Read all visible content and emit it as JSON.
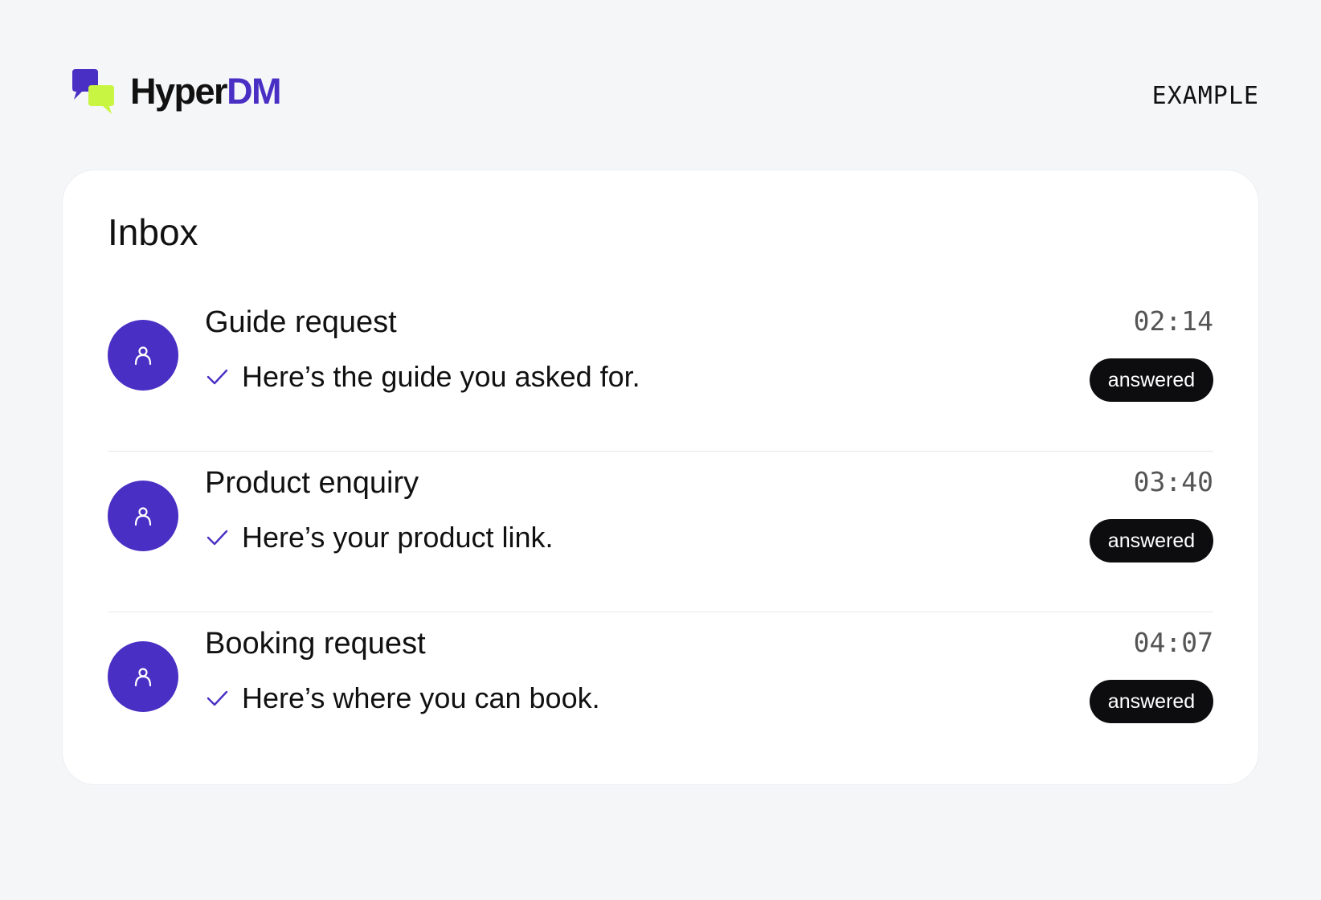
{
  "brand": {
    "name_part1": "Hyper",
    "name_part2": "DM",
    "accent_color": "#4a2fc4",
    "secondary_color": "#c8f542"
  },
  "header": {
    "label": "EXAMPLE"
  },
  "inbox": {
    "title": "Inbox",
    "items": [
      {
        "title": "Guide request",
        "message": "Here’s the guide you asked for.",
        "time": "02:14",
        "status": "answered",
        "icon": "user-icon"
      },
      {
        "title": "Product enquiry",
        "message": "Here’s your product link.",
        "time": "03:40",
        "status": "answered",
        "icon": "user-icon"
      },
      {
        "title": "Booking request",
        "message": "Here’s where you can book.",
        "time": "04:07",
        "status": "answered",
        "icon": "user-icon"
      }
    ]
  }
}
